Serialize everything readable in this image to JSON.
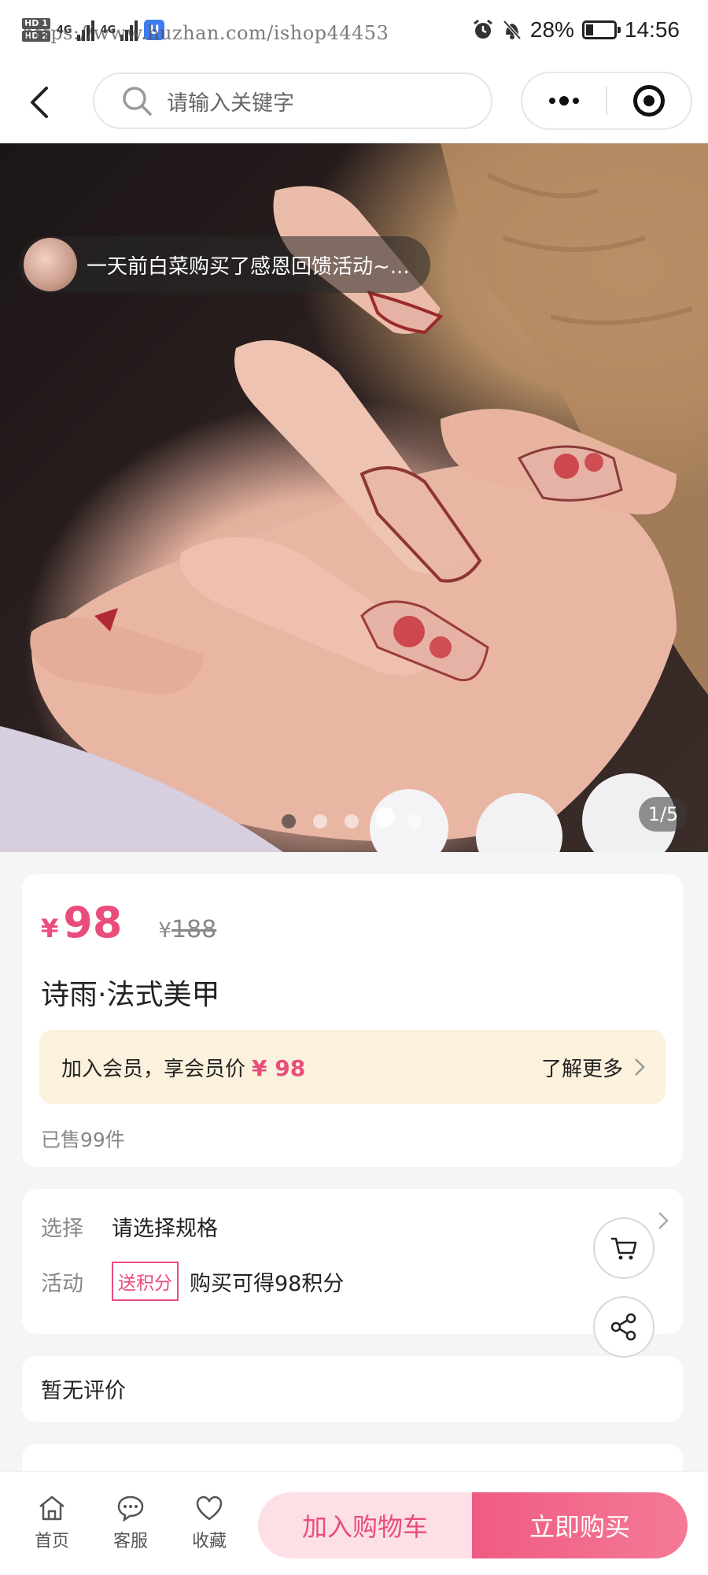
{
  "status_bar": {
    "hd_top": "HD 1",
    "hd_bottom": "HD 2",
    "net_1": "4G",
    "net_2": "4G",
    "app_badge": "U",
    "url_watermark": "https://www.huzhan.com/ishop44453",
    "battery_percent": "28%",
    "battery_level": 0.28,
    "time": "14:56",
    "icons": [
      "alarm-icon",
      "mute-bell-icon",
      "battery-icon"
    ]
  },
  "header": {
    "search_placeholder": "请输入关键字",
    "icons": [
      "back-chevron-icon",
      "search-icon",
      "more-dots-icon",
      "target-icon"
    ]
  },
  "gallery": {
    "toast_text": "一天前白菜购买了感恩回馈活动~...",
    "page_counter": "1/5",
    "total_pages": 5,
    "current_page": 1
  },
  "price": {
    "symbol": "¥",
    "current": "98",
    "original_symbol": "¥",
    "original": "188"
  },
  "product": {
    "title": "诗雨·法式美甲",
    "sold": "已售99件"
  },
  "member": {
    "text": "加入会员，享会员价",
    "price": "¥ 98",
    "more": "了解更多"
  },
  "spec": {
    "select_key": "选择",
    "select_value": "请选择规格",
    "activity_key": "活动",
    "activity_tag": "送积分",
    "activity_value": "购买可得98积分"
  },
  "reviews": {
    "text": "暂无评价"
  },
  "bottom_nav": {
    "home": "首页",
    "service": "客服",
    "favorite": "收藏",
    "add_cart": "加入购物车",
    "buy_now": "立即购买"
  },
  "colors": {
    "accent": "#e94d7b",
    "member_bg": "#fbf1dc",
    "cart_bg": "#fde0e6"
  }
}
